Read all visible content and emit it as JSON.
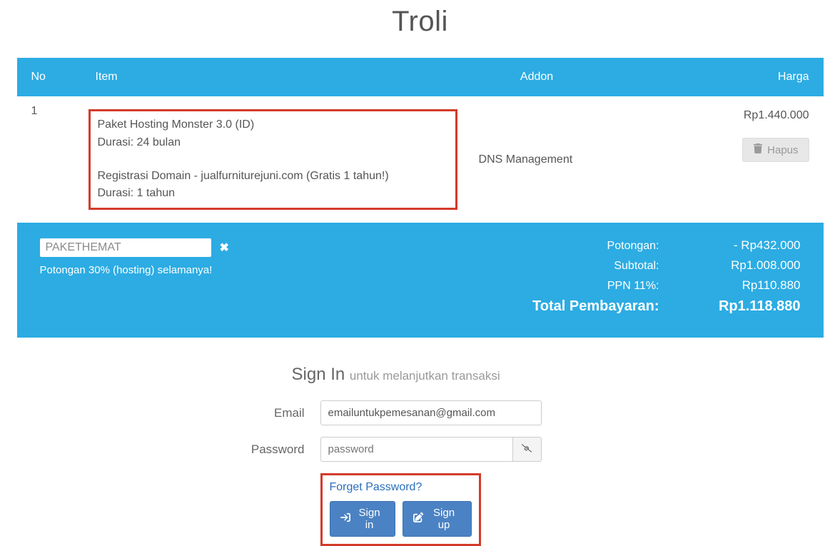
{
  "page": {
    "title": "Troli"
  },
  "table": {
    "headers": {
      "no": "No",
      "item": "Item",
      "addon": "Addon",
      "harga": "Harga"
    },
    "rows": [
      {
        "no": "1",
        "item_line1": "Paket Hosting Monster 3.0 (ID)",
        "item_line2": "Durasi: 24 bulan",
        "item_line3": "Registrasi Domain - jualfurniturejuni.com (Gratis 1 tahun!)",
        "item_line4": "Durasi: 1 tahun",
        "addon": "DNS Management",
        "price": "Rp1.440.000",
        "delete_label": "Hapus"
      }
    ]
  },
  "promo": {
    "code": "PAKETHEMAT",
    "desc": "Potongan 30% (hosting) selamanya!"
  },
  "summary": {
    "potongan": {
      "label": "Potongan:",
      "value": "- Rp432.000"
    },
    "subtotal": {
      "label": "Subtotal:",
      "value": "Rp1.008.000"
    },
    "ppn": {
      "label": "PPN 11%:",
      "value": "Rp110.880"
    },
    "total": {
      "label": "Total Pembayaran:",
      "value": "Rp1.118.880"
    }
  },
  "signin": {
    "heading": "Sign In",
    "subheading": "untuk melanjutkan transaksi",
    "email_label": "Email",
    "email_value": "emailuntukpemesanan@gmail.com",
    "password_label": "Password",
    "password_placeholder": "password",
    "forget": "Forget Password?",
    "signin_btn": "Sign in",
    "signup_btn": "Sign up"
  }
}
